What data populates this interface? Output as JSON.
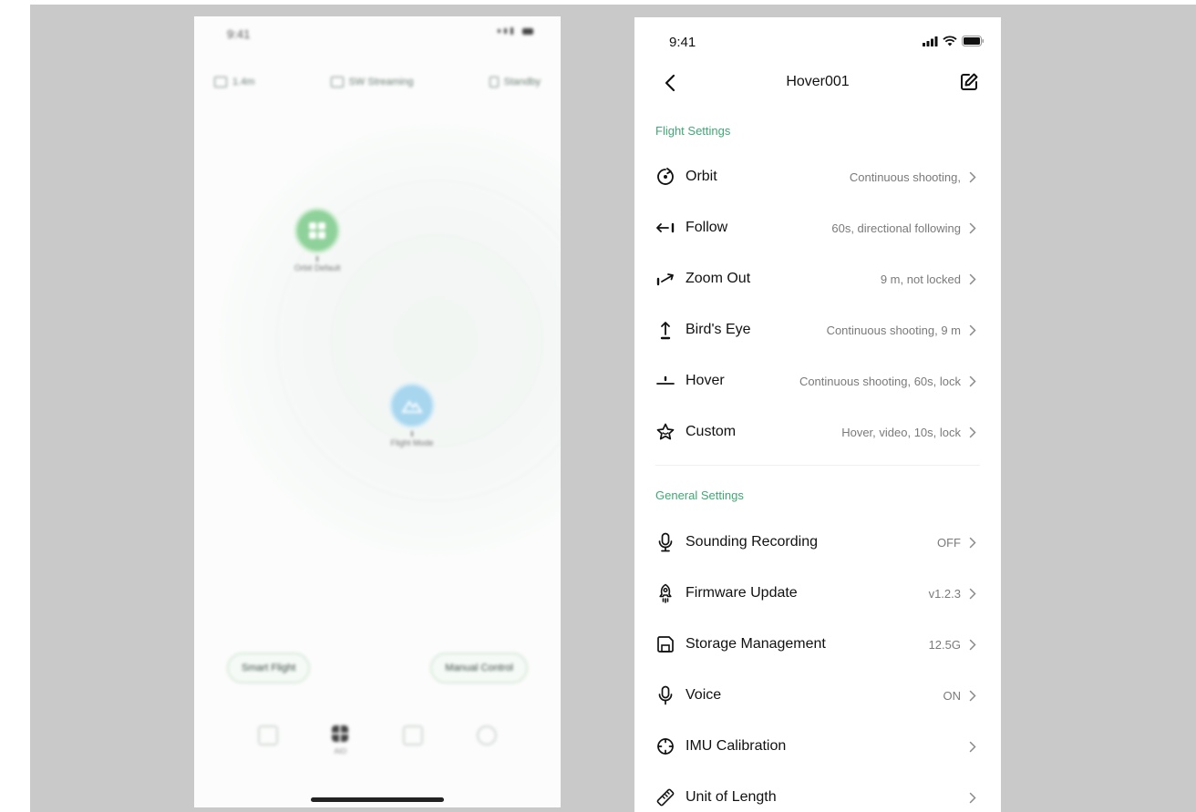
{
  "left_screen": {
    "status_time": "9:41",
    "top_items": [
      "1.4m",
      "SW Streaming",
      "Standby"
    ],
    "nodes": [
      {
        "label": "Orbit Default",
        "color": "#8fd19a"
      },
      {
        "label": "Flight Mode",
        "color": "#a8d6ef"
      }
    ],
    "pills": [
      "Smart Flight",
      "Manual Control"
    ],
    "tabs": [
      "",
      "AIO",
      "",
      ""
    ]
  },
  "right_screen": {
    "status_time": "9:41",
    "nav_title": "Hover001",
    "flight_section_label": "Flight Settings",
    "flight_rows": [
      {
        "label": "Orbit",
        "value": "Continuous shooting,",
        "icon": "orbit-icon"
      },
      {
        "label": "Follow",
        "value": "60s, directional following",
        "icon": "follow-icon"
      },
      {
        "label": "Zoom Out",
        "value": "9 m, not locked",
        "icon": "zoom-out-icon"
      },
      {
        "label": "Bird's Eye",
        "value": "Continuous shooting, 9 m",
        "icon": "birds-eye-icon"
      },
      {
        "label": "Hover",
        "value": "Continuous shooting, 60s, lock",
        "icon": "hover-icon"
      },
      {
        "label": "Custom",
        "value": "Hover, video, 10s, lock",
        "icon": "star-icon"
      }
    ],
    "general_section_label": "General Settings",
    "general_rows": [
      {
        "label": "Sounding Recording",
        "value": "OFF",
        "icon": "microphone-icon"
      },
      {
        "label": "Firmware Update",
        "value": "v1.2.3",
        "icon": "rocket-icon"
      },
      {
        "label": "Storage Management",
        "value": "12.5G",
        "icon": "save-icon"
      },
      {
        "label": "Voice",
        "value": "ON",
        "icon": "microphone-icon"
      },
      {
        "label": "IMU Calibration",
        "value": "",
        "icon": "crosshair-icon"
      },
      {
        "label": "Unit of Length",
        "value": "",
        "icon": "ruler-icon"
      }
    ],
    "colors": {
      "accent": "#3fa874",
      "text": "#111111",
      "value": "#7a7a7a"
    }
  }
}
